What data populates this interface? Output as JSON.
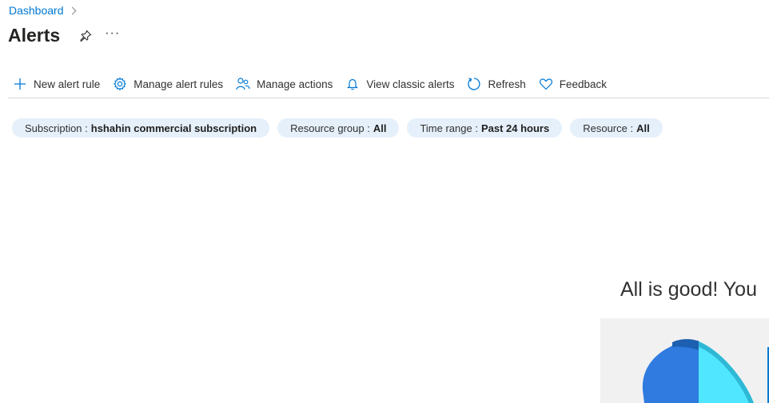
{
  "breadcrumb": {
    "root": "Dashboard"
  },
  "page": {
    "title": "Alerts",
    "more": "···"
  },
  "toolbar": {
    "new_alert_rule": "New alert rule",
    "manage_alert_rules": "Manage alert rules",
    "manage_actions": "Manage actions",
    "view_classic_alerts": "View classic alerts",
    "refresh": "Refresh",
    "feedback": "Feedback"
  },
  "filters": [
    {
      "label": "Subscription :",
      "value": "hshahin commercial subscription"
    },
    {
      "label": "Resource group :",
      "value": "All"
    },
    {
      "label": "Time range :",
      "value": "Past 24 hours"
    },
    {
      "label": "Resource :",
      "value": "All"
    }
  ],
  "empty_state": {
    "message": "All is good! You"
  },
  "colors": {
    "accent": "#0078d4",
    "pill_bg": "#e5f0fb",
    "illus_blue": "#2f7be0",
    "illus_cyan": "#50e6ff"
  },
  "icons": [
    "chevron-right-icon",
    "pin-icon",
    "more-icon",
    "plus-icon",
    "gear-icon",
    "people-icon",
    "bell-icon",
    "refresh-icon",
    "heart-icon"
  ]
}
